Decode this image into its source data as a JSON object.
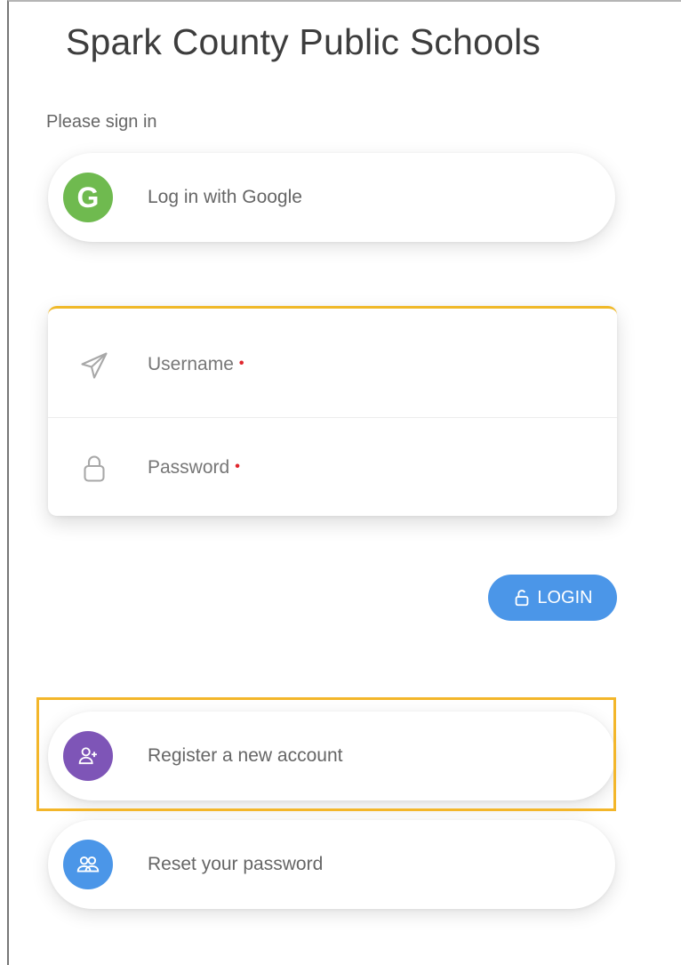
{
  "header": {
    "title": "Spark County Public Schools"
  },
  "signin": {
    "prompt": "Please sign in"
  },
  "google": {
    "avatar_letter": "G",
    "label": "Log in with Google",
    "color": "#6fba4f"
  },
  "form": {
    "username_label": "Username",
    "password_label": "Password",
    "required_marker": "•",
    "accent_color": "#f0b929"
  },
  "login": {
    "label": "LOGIN",
    "icon": "unlock-icon",
    "color": "#4b96e8"
  },
  "links": {
    "register": {
      "label": "Register a new account",
      "icon": "user-plus-icon",
      "color": "#7e55b7"
    },
    "reset": {
      "label": "Reset your password",
      "icon": "users-icon",
      "color": "#4b96e8"
    }
  }
}
